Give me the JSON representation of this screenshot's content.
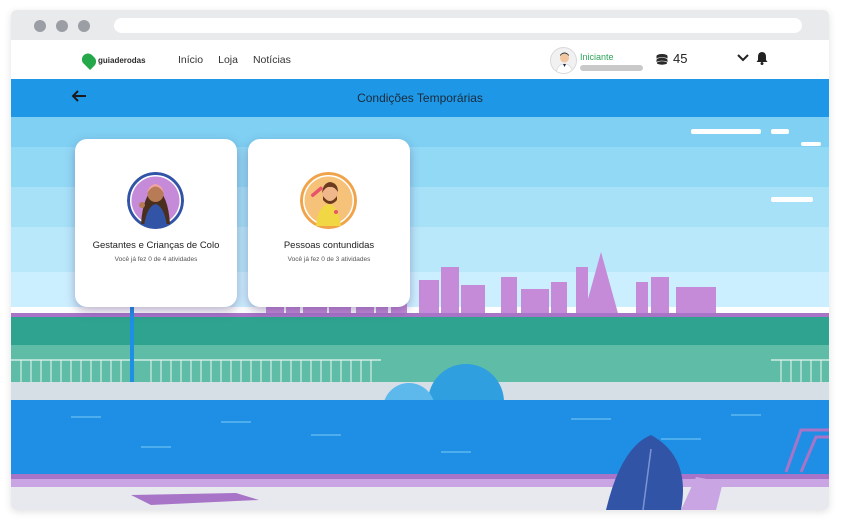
{
  "brand": {
    "name": "guiaderodas",
    "color": "#24a84a"
  },
  "nav": {
    "links": [
      "Início",
      "Loja",
      "Notícias"
    ]
  },
  "user": {
    "level": "Iniciante",
    "coins": "45",
    "progress": 0
  },
  "header": {
    "title": "Condições Temporárias"
  },
  "cards": [
    {
      "title": "Gestantes e Crianças de Colo",
      "subtitle": "Você já fez 0 de 4 atividades"
    },
    {
      "title": "Pessoas contundidas",
      "subtitle": "Você já fez 0 de 3 atividades"
    }
  ],
  "colors": {
    "header": "#1e98e6",
    "sky": "#a9e3f7",
    "water": "#1e8fe5",
    "city": "#c58ad8"
  }
}
